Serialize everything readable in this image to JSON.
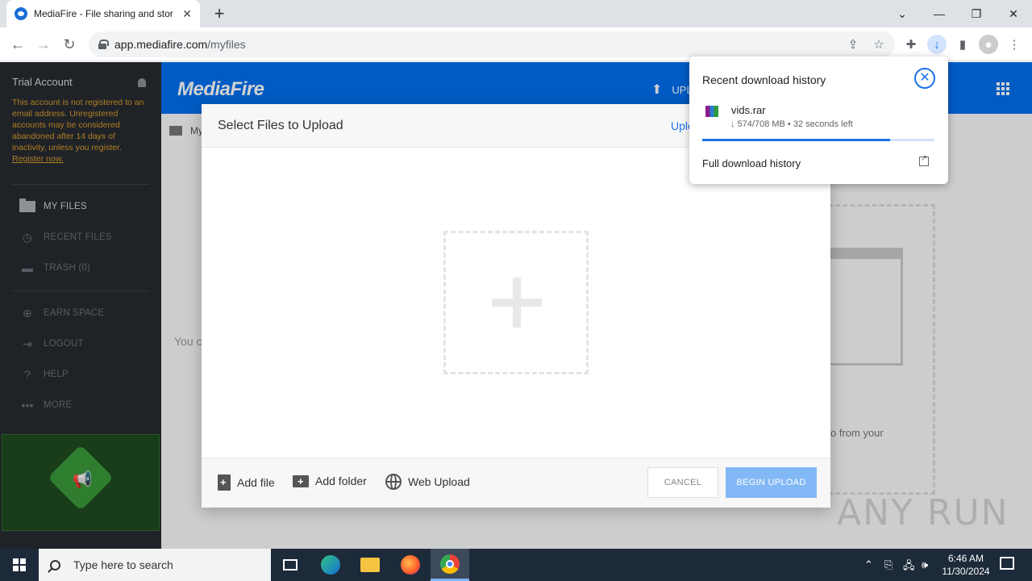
{
  "browser": {
    "tab_title": "MediaFire - File sharing and stor",
    "url_host": "app.mediafire.com",
    "url_path": "/myfiles"
  },
  "sidebar": {
    "account_title": "Trial Account",
    "trial_message": "This account is not registered to an email address. Unregistered accounts may be considered abandoned after 14 days of inactivity, unless you register.",
    "register_link": "Register now.",
    "items": [
      {
        "label": "MY FILES",
        "icon": "folder-icon"
      },
      {
        "label": "RECENT FILES",
        "icon": "clock-icon"
      },
      {
        "label": "TRASH (0)",
        "icon": "trash-icon"
      },
      {
        "label": "EARN SPACE",
        "icon": "plus-circle-icon"
      },
      {
        "label": "LOGOUT",
        "icon": "logout-icon"
      },
      {
        "label": "HELP",
        "icon": "help-icon"
      },
      {
        "label": "MORE",
        "icon": "more-icon"
      }
    ]
  },
  "header": {
    "logo": "MediaFire",
    "upload_label": "UPL"
  },
  "main": {
    "breadcrumb": "My",
    "empty_text": "You c",
    "hint_text": "o from your"
  },
  "modal": {
    "title": "Select Files to Upload",
    "upload_to_label": "Uplo",
    "add_file": "Add file",
    "add_folder": "Add folder",
    "web_upload": "Web Upload",
    "cancel": "CANCEL",
    "begin_upload": "BEGIN UPLOAD"
  },
  "downloads": {
    "title": "Recent download history",
    "file_name": "vids.rar",
    "status": "↓ 574/708 MB • 32 seconds left",
    "progress": 0.81,
    "full_history": "Full download history"
  },
  "taskbar": {
    "search_placeholder": "Type here to search",
    "time": "6:46 AM",
    "date": "11/30/2024"
  },
  "watermark": "ANY RUN"
}
